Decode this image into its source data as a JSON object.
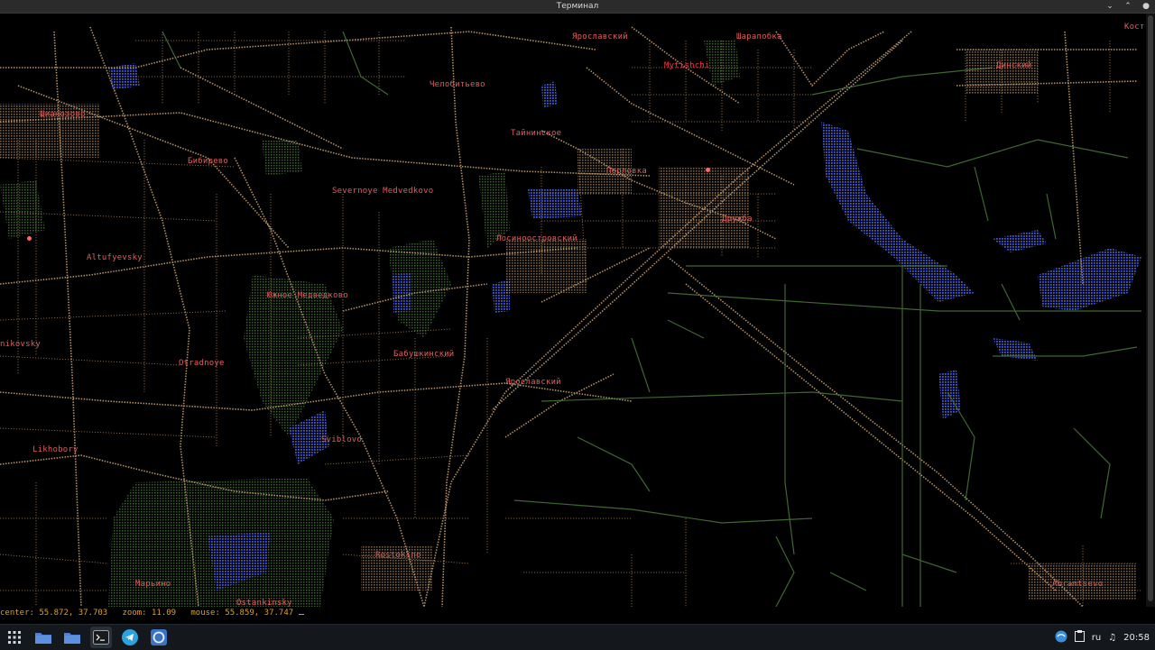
{
  "window": {
    "title": "Терминал",
    "minimize_glyph": "⌄",
    "restore_glyph": "⌃",
    "close_glyph": "●"
  },
  "places": [
    {
      "name": "Ярославский",
      "bright": false
    },
    {
      "name": "Шарапобка",
      "bright": false
    },
    {
      "name": "Кост",
      "bright": false
    },
    {
      "name": "Mytishchi",
      "bright": true
    },
    {
      "name": "Динский",
      "bright": false
    },
    {
      "name": "Челобитьево",
      "bright": false
    },
    {
      "name": "Шианозово",
      "bright": false
    },
    {
      "name": "Тайнинское",
      "bright": false
    },
    {
      "name": "Бибирево",
      "bright": false
    },
    {
      "name": "Перловка",
      "bright": false
    },
    {
      "name": "Severnoye Medvedkovo",
      "bright": false
    },
    {
      "name": "Дружба",
      "bright": false
    },
    {
      "name": "Лосиноостровский",
      "bright": false
    },
    {
      "name": "Altufyevsky",
      "bright": false
    },
    {
      "name": "Южное Медведково",
      "bright": false
    },
    {
      "name": "nikovsky",
      "bright": false
    },
    {
      "name": "Бабушкинский",
      "bright": false
    },
    {
      "name": "Otradnoye",
      "bright": false
    },
    {
      "name": "Ярославский",
      "bright": false
    },
    {
      "name": "Sviblovo",
      "bright": false
    },
    {
      "name": "Likhobory",
      "bright": false
    },
    {
      "name": "Rostokino",
      "bright": false
    },
    {
      "name": "Марьино",
      "bright": false
    },
    {
      "name": "Ostankinsky",
      "bright": false
    },
    {
      "name": "Abramtsevo",
      "bright": false
    }
  ],
  "status": {
    "center_label": "center:",
    "center_value": "55.872, 37.703",
    "zoom_label": "zoom:",
    "zoom_value": "11.09",
    "mouse_label": "mouse:",
    "mouse_value": "55.859, 37.747"
  },
  "taskbar": {
    "apps": [
      "apps-grid-icon",
      "folder-icon",
      "folder-icon",
      "terminal-icon",
      "telegram-icon",
      "browser-icon"
    ],
    "lang": "ru",
    "time": "20:58"
  },
  "colors": {
    "roads": "#c9a070",
    "green": "#4a7a3a",
    "water": "#3a4fc0",
    "labels": "#e05d5d",
    "status": "#e0a020"
  }
}
